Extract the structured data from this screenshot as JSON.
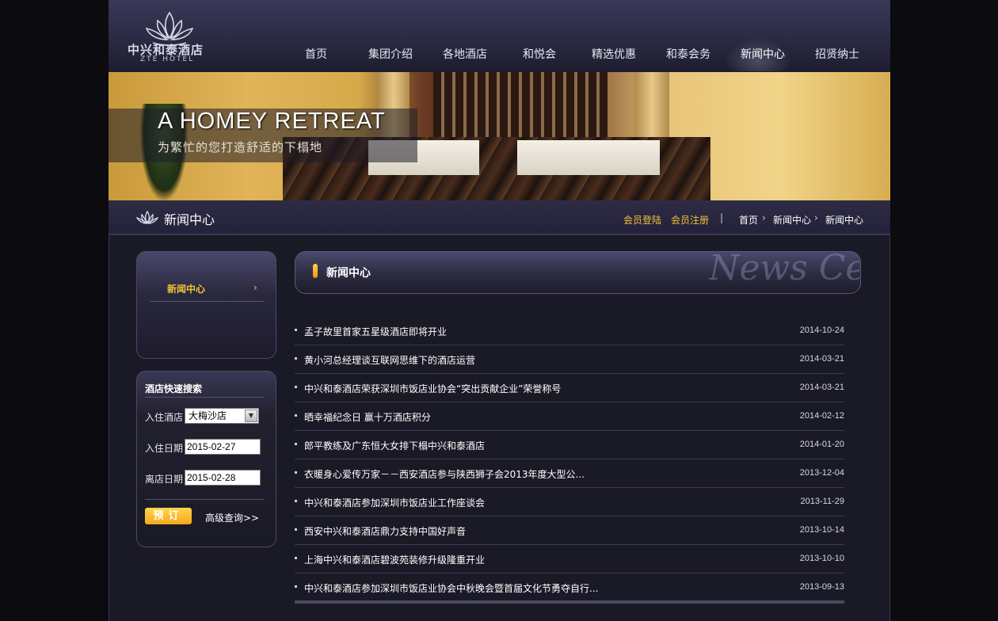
{
  "brand": {
    "name_cn": "中兴和泰酒店",
    "name_en": "ZTE HOTEL"
  },
  "nav": [
    {
      "label": "首页"
    },
    {
      "label": "集团介绍"
    },
    {
      "label": "各地酒店"
    },
    {
      "label": "和悦会"
    },
    {
      "label": "精选优惠"
    },
    {
      "label": "和泰会务"
    },
    {
      "label": "新闻中心",
      "active": true
    },
    {
      "label": "招贤纳士"
    }
  ],
  "banner": {
    "headline": "A HOMEY  RETREAT",
    "subline": "为繁忙的您打造舒适的下榻地"
  },
  "subbar": {
    "section_title": "新闻中心",
    "member_login": "会员登陆",
    "member_register": "会员注册",
    "separator": "|",
    "breadcrumb": [
      "首页",
      "新闻中心",
      "新闻中心"
    ],
    "breadcrumb_sep": "›"
  },
  "sidebar": {
    "menu_item": "新闻中心",
    "menu_arrow": "›"
  },
  "search": {
    "title": "酒店快速搜索",
    "hotel_label": "入住酒店",
    "hotel_value": "大梅沙店",
    "checkin_label": "入住日期",
    "checkin_value": "2015-02-27",
    "checkout_label": "离店日期",
    "checkout_value": "2015-02-28",
    "book_button": "预订",
    "advanced_link": "高级查询>>"
  },
  "content": {
    "title": "新闻中心",
    "watermark": "News Center"
  },
  "news": [
    {
      "title": "孟子故里首家五星级酒店即将开业",
      "date": "2014-10-24"
    },
    {
      "title": "黄小河总经理谈互联网思维下的酒店运营",
      "date": "2014-03-21"
    },
    {
      "title": "中兴和泰酒店荣获深圳市饭店业协会“突出贡献企业”荣誉称号",
      "date": "2014-03-21"
    },
    {
      "title": "晒幸福纪念日 赢十万酒店积分",
      "date": "2014-02-12"
    },
    {
      "title": "郎平教练及广东恒大女排下榻中兴和泰酒店",
      "date": "2014-01-20"
    },
    {
      "title": "衣暖身心爱传万家－－西安酒店参与陕西狮子会2013年度大型公...",
      "date": "2013-12-04"
    },
    {
      "title": "中兴和泰酒店参加深圳市饭店业工作座谈会",
      "date": "2013-11-29"
    },
    {
      "title": "西安中兴和泰酒店鼎力支持中国好声音",
      "date": "2013-10-14"
    },
    {
      "title": "上海中兴和泰酒店碧波苑装修升级隆重开业",
      "date": "2013-10-10"
    },
    {
      "title": "中兴和泰酒店参加深圳市饭店业协会中秋晚会暨首届文化节勇夺自行...",
      "date": "2013-09-13"
    }
  ],
  "colors": {
    "accent": "#f2c23a",
    "background": "#1a1926",
    "header": "#2b2a44"
  }
}
